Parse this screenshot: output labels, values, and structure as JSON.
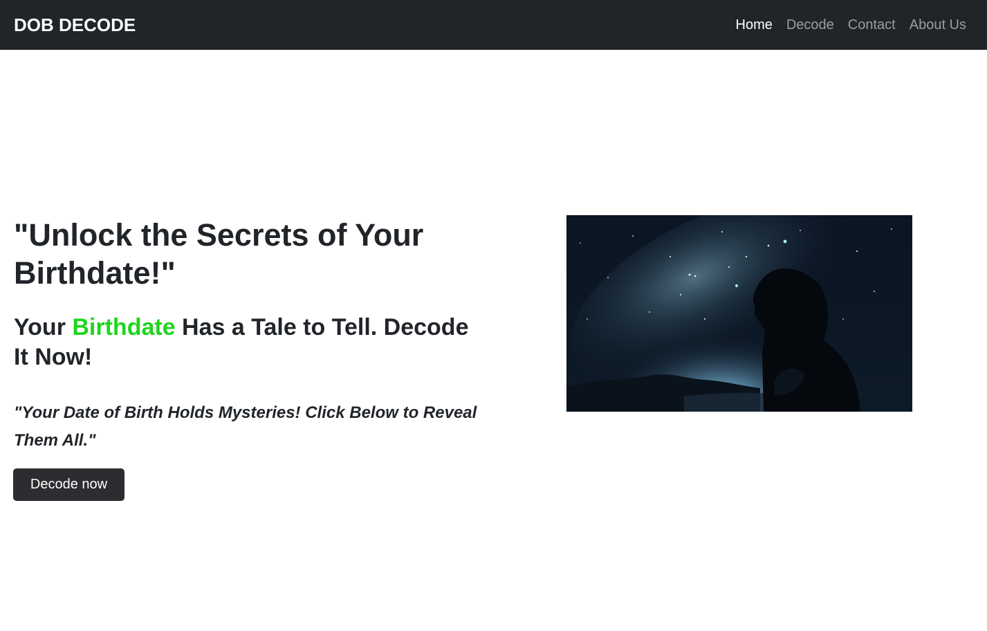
{
  "brand": "DOB DECODE",
  "nav": {
    "items": [
      {
        "label": "Home",
        "active": true
      },
      {
        "label": "Decode",
        "active": false
      },
      {
        "label": "Contact",
        "active": false
      },
      {
        "label": "About Us",
        "active": false
      }
    ]
  },
  "hero": {
    "title": "\"Unlock the Secrets of Your Birthdate!\"",
    "subtitle_before": "Your ",
    "subtitle_highlight": "Birthdate",
    "subtitle_after": " Has a Tale to Tell. Decode It Now!",
    "tagline": "\"Your Date of Birth Holds Mysteries! Click Below to Reveal Them All.\"",
    "button_label": "Decode now",
    "image_description": "silhouette of a woman gazing up at a starry night sky"
  },
  "colors": {
    "navbar_bg": "#212529",
    "highlight": "#1ed51e",
    "button_bg": "#2b2d30"
  }
}
